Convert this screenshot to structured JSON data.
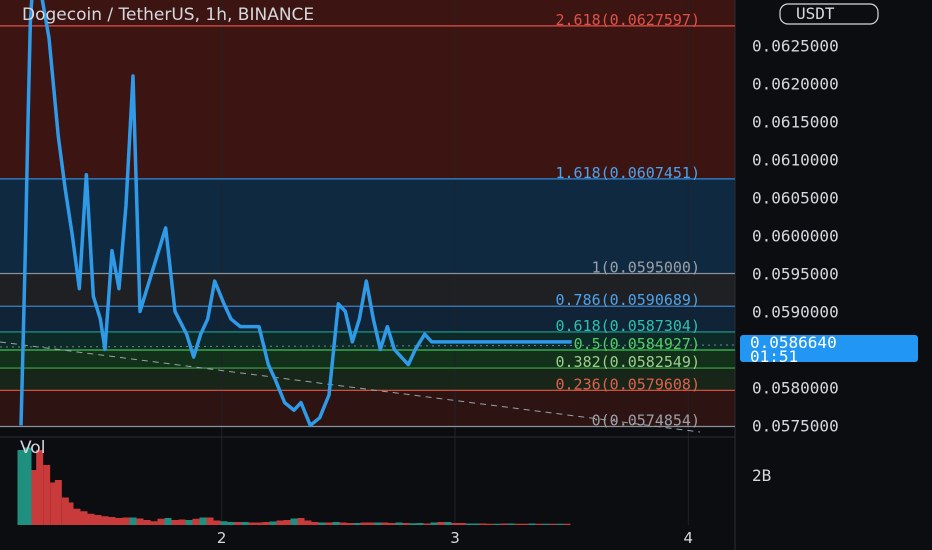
{
  "title": "Dogecoin / TetherUS, 1h, BINANCE",
  "currency_badge": "USDT",
  "price_label": {
    "price": "0.0586640",
    "countdown": "01:51",
    "value": 0.058664,
    "color": "#2196f3"
  },
  "volume_label": "Vol",
  "volume_axis_label": "2B",
  "colors": {
    "line": "#2e9ae8",
    "bull": "#1f8f80",
    "bear": "#c93a3a"
  },
  "chart_data": {
    "type": "line",
    "title": "Dogecoin / TetherUS, 1h, BINANCE",
    "ylim": [
      0.0574,
      0.0631
    ],
    "xlim": [
      1.05,
      4.2
    ],
    "y_ticks": [
      {
        "value": 0.0625,
        "label": "0.0625000"
      },
      {
        "value": 0.062,
        "label": "0.0620000"
      },
      {
        "value": 0.0615,
        "label": "0.0615000"
      },
      {
        "value": 0.061,
        "label": "0.0610000"
      },
      {
        "value": 0.0605,
        "label": "0.0605000"
      },
      {
        "value": 0.06,
        "label": "0.0600000"
      },
      {
        "value": 0.0595,
        "label": "0.0595000"
      },
      {
        "value": 0.059,
        "label": "0.0590000"
      },
      {
        "value": 0.058,
        "label": "0.0580000"
      },
      {
        "value": 0.0575,
        "label": "0.0575000"
      }
    ],
    "x_ticks": [
      {
        "value": 2,
        "label": "2"
      },
      {
        "value": 3,
        "label": "3"
      },
      {
        "value": 4,
        "label": "4"
      }
    ],
    "fib_levels": [
      {
        "label": "2.618(0.0627597)",
        "value": 0.0627597,
        "line": "#e0504a",
        "text": "#e0504a"
      },
      {
        "label": "1.618(0.0607451)",
        "value": 0.0607451,
        "line": "#2f8ad8",
        "text": "#4aa3ee"
      },
      {
        "label": "1(0.0595000)",
        "value": 0.0595,
        "line": "#8a8f98",
        "text": "#9aa0a8"
      },
      {
        "label": "0.786(0.0590689)",
        "value": 0.0590689,
        "line": "#3f7fc0",
        "text": "#4aa3ee"
      },
      {
        "label": "0.618(0.0587304)",
        "value": 0.0587304,
        "line": "#1fa090",
        "text": "#2cc1ad"
      },
      {
        "label": "0.5(0.0584927)",
        "value": 0.0584927,
        "line": "#3fbf50",
        "text": "#4fd060"
      },
      {
        "label": "0.382(0.0582549)",
        "value": 0.0582549,
        "line": "#3fa848",
        "text": "#9ad08a"
      },
      {
        "label": "0.236(0.0579608)",
        "value": 0.0579608,
        "line": "#d05040",
        "text": "#e0604c"
      },
      {
        "label": "0(0.0574854)",
        "value": 0.0574854,
        "line": "#8a8f98",
        "text": "#9aa0a8"
      }
    ],
    "zones": [
      {
        "from": 0.0607451,
        "to": 0.0631,
        "color": "#3c1512"
      },
      {
        "from": 0.0595,
        "to": 0.0607451,
        "color": "#0f2a40"
      },
      {
        "from": 0.0590689,
        "to": 0.0595,
        "color": "#1f2024"
      },
      {
        "from": 0.0587304,
        "to": 0.0590689,
        "color": "#112437"
      },
      {
        "from": 0.0584927,
        "to": 0.0587304,
        "color": "#0e2a28"
      },
      {
        "from": 0.0582549,
        "to": 0.0584927,
        "color": "#12301a"
      },
      {
        "from": 0.0579608,
        "to": 0.0582549,
        "color": "#18261a"
      },
      {
        "from": 0.0574854,
        "to": 0.0579608,
        "color": "#2d1412"
      }
    ],
    "series": [
      {
        "x": [
          1.14,
          1.15,
          1.16,
          1.17,
          1.18,
          1.19,
          1.2,
          1.21,
          1.22,
          1.26,
          1.3,
          1.33,
          1.36,
          1.39,
          1.42,
          1.45,
          1.48,
          1.5,
          1.53,
          1.56,
          1.59,
          1.62,
          1.65,
          1.68,
          1.71,
          1.73,
          1.76,
          1.8,
          1.85,
          1.88,
          1.91,
          1.94,
          1.97,
          2.01,
          2.04,
          2.08,
          2.12,
          2.16,
          2.2,
          2.23,
          2.27,
          2.31,
          2.34,
          2.38,
          2.42,
          2.46,
          2.5,
          2.53,
          2.56,
          2.59,
          2.62,
          2.65,
          2.68,
          2.71,
          2.74,
          2.77,
          2.8,
          2.83,
          2.87,
          2.9,
          2.93,
          2.97,
          3.0,
          3.02,
          3.06,
          3.09,
          3.12,
          3.15,
          3.18,
          3.21,
          3.24,
          3.27,
          3.29,
          3.32,
          3.35,
          3.38,
          3.41,
          3.44,
          3.47,
          3.5
        ],
        "values": [
          0.0575,
          0.0587,
          0.06,
          0.0615,
          0.0628,
          0.0633,
          0.0636,
          0.0636,
          0.0633,
          0.0626,
          0.0613,
          0.0606,
          0.06,
          0.0593,
          0.0608,
          0.0592,
          0.0589,
          0.0585,
          0.0598,
          0.0593,
          0.0604,
          0.0621,
          0.059,
          0.0593,
          0.0596,
          0.0598,
          0.0601,
          0.059,
          0.0587,
          0.0584,
          0.0587,
          0.0589,
          0.0594,
          0.0591,
          0.0589,
          0.0588,
          0.0588,
          0.0588,
          0.0583,
          0.0581,
          0.0578,
          0.0577,
          0.0578,
          0.0575,
          0.0576,
          0.0579,
          0.0591,
          0.059,
          0.0586,
          0.0589,
          0.0594,
          0.0589,
          0.0585,
          0.0588,
          0.0585,
          0.0584,
          0.0583,
          0.0585,
          0.0587,
          0.0586,
          0.0586,
          0.0586,
          0.0586,
          0.0586,
          0.0586,
          0.0586,
          0.0586,
          0.0586,
          0.0586,
          0.0586,
          0.0586,
          0.0586,
          0.0586,
          0.0586,
          0.0586,
          0.0586,
          0.0586,
          0.0586,
          0.0586,
          0.0586
        ]
      }
    ],
    "volume": {
      "x": [
        1.14,
        1.17,
        1.2,
        1.22,
        1.25,
        1.28,
        1.3,
        1.33,
        1.35,
        1.38,
        1.41,
        1.44,
        1.47,
        1.5,
        1.53,
        1.56,
        1.59,
        1.62,
        1.65,
        1.68,
        1.71,
        1.74,
        1.77,
        1.8,
        1.83,
        1.86,
        1.89,
        1.92,
        1.95,
        1.98,
        2.01,
        2.04,
        2.07,
        2.1,
        2.13,
        2.16,
        2.19,
        2.22,
        2.25,
        2.28,
        2.31,
        2.34,
        2.37,
        2.4,
        2.43,
        2.46,
        2.49,
        2.52,
        2.55,
        2.58,
        2.61,
        2.64,
        2.67,
        2.7,
        2.73,
        2.76,
        2.79,
        2.82,
        2.85,
        2.88,
        2.91,
        2.94,
        2.97,
        3.0,
        3.03,
        3.06,
        3.09,
        3.12,
        3.15,
        3.18,
        3.21,
        3.24,
        3.27,
        3.3,
        3.33,
        3.36,
        3.39,
        3.42,
        3.45,
        3.48
      ],
      "values": [
        3.0,
        3.1,
        2.2,
        3.0,
        2.4,
        1.7,
        1.8,
        1.1,
        0.9,
        0.65,
        0.55,
        0.45,
        0.4,
        0.35,
        0.32,
        0.28,
        0.3,
        0.3,
        0.26,
        0.2,
        0.15,
        0.25,
        0.28,
        0.2,
        0.22,
        0.2,
        0.25,
        0.3,
        0.3,
        0.18,
        0.15,
        0.12,
        0.12,
        0.12,
        0.1,
        0.1,
        0.12,
        0.14,
        0.18,
        0.2,
        0.26,
        0.28,
        0.18,
        0.12,
        0.1,
        0.1,
        0.12,
        0.1,
        0.08,
        0.08,
        0.1,
        0.1,
        0.1,
        0.1,
        0.08,
        0.1,
        0.08,
        0.07,
        0.08,
        0.06,
        0.1,
        0.12,
        0.12,
        0.08,
        0.08,
        0.06,
        0.06,
        0.06,
        0.05,
        0.05,
        0.06,
        0.06,
        0.05,
        0.05,
        0.06,
        0.05,
        0.05,
        0.05,
        0.05,
        0.05
      ],
      "up": [
        true,
        true,
        false,
        false,
        false,
        false,
        false,
        false,
        false,
        false,
        false,
        false,
        false,
        false,
        false,
        false,
        false,
        true,
        false,
        false,
        false,
        false,
        true,
        false,
        false,
        true,
        false,
        true,
        false,
        false,
        true,
        true,
        false,
        true,
        false,
        false,
        false,
        true,
        false,
        false,
        true,
        false,
        false,
        false,
        true,
        false,
        true,
        false,
        false,
        true,
        false,
        false,
        true,
        false,
        false,
        true,
        false,
        true,
        true,
        false,
        true,
        false,
        true,
        false,
        false,
        true,
        true,
        false,
        false,
        true,
        false,
        true,
        false,
        false,
        true,
        false,
        true,
        false,
        true,
        false
      ]
    }
  }
}
